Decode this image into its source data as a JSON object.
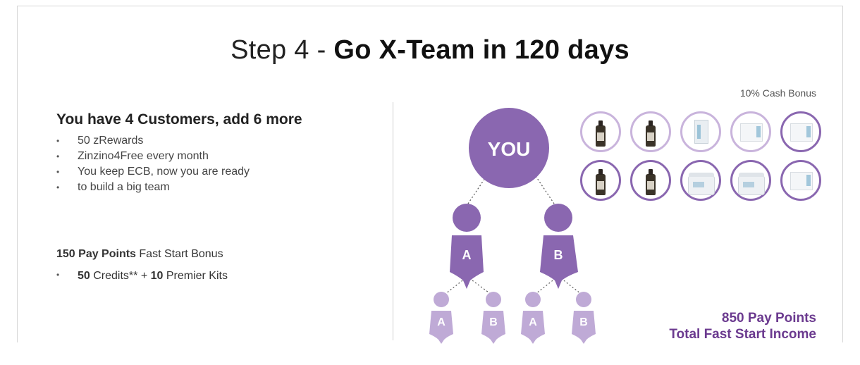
{
  "title": {
    "prefix": "Step 4 - ",
    "bold": "Go X-Team in 120 days"
  },
  "cash_bonus": "10% Cash Bonus",
  "left": {
    "heading": "You have 4 Customers, add 6 more",
    "bullets": [
      "50 zRewards",
      "Zinzino4Free every month",
      "You keep ECB, now you are ready",
      "to build a big team"
    ]
  },
  "fast_start": {
    "pay_points_bold": "150 Pay Points",
    "pay_points_text": " Fast Start Bonus",
    "credits_num": "50",
    "credits_text": " Credits** + ",
    "kits_num": "10",
    "kits_text": " Premier Kits"
  },
  "tree": {
    "you": "YOU",
    "a": "A",
    "b": "B",
    "sub": [
      "A",
      "B",
      "A",
      "B"
    ]
  },
  "total": {
    "line1": "850 Pay Points",
    "line2": "Total Fast Start Income"
  },
  "colors": {
    "purple_dark": "#8a67b0",
    "purple_light": "#bfaad6",
    "text_purple": "#6b3a8f"
  },
  "products": [
    {
      "icon": "oil-bottle-icon"
    },
    {
      "icon": "oil-bottle-icon"
    },
    {
      "icon": "supplement-tube-icon"
    },
    {
      "icon": "supplement-box-icon"
    },
    {
      "icon": "supplement-box-icon"
    },
    {
      "icon": "oil-bottle-icon"
    },
    {
      "icon": "oil-bottle-icon"
    },
    {
      "icon": "supplement-jar-icon"
    },
    {
      "icon": "supplement-jar-icon"
    },
    {
      "icon": "supplement-box-icon"
    }
  ]
}
